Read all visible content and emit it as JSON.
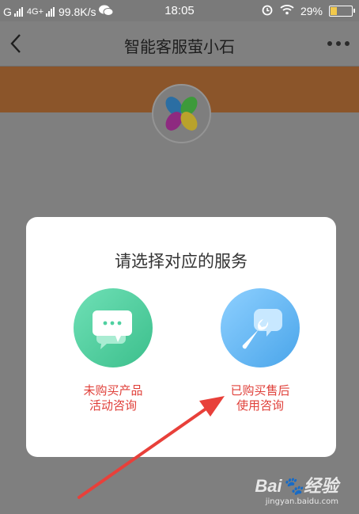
{
  "status_bar": {
    "carrier1": "G",
    "carrier2": "4G+",
    "speed": "99.8K/s",
    "time": "18:05",
    "battery": "29%",
    "battery_level": 0.29
  },
  "nav": {
    "title": "智能客服萤小石"
  },
  "dialog": {
    "title": "请选择对应的服务",
    "options": [
      {
        "line1": "未购买产品",
        "line2": "活动咨询",
        "icon": "chat-bubble-icon",
        "color": "#4fd0a0"
      },
      {
        "line1": "已购买售后",
        "line2": "使用咨询",
        "icon": "wrench-chat-icon",
        "color": "#64b6f5"
      }
    ]
  },
  "annotation": {
    "color": "#e8403a"
  },
  "watermark": {
    "brand": "Bai",
    "brand2": "经验",
    "url": "jingyan.baidu.com"
  }
}
